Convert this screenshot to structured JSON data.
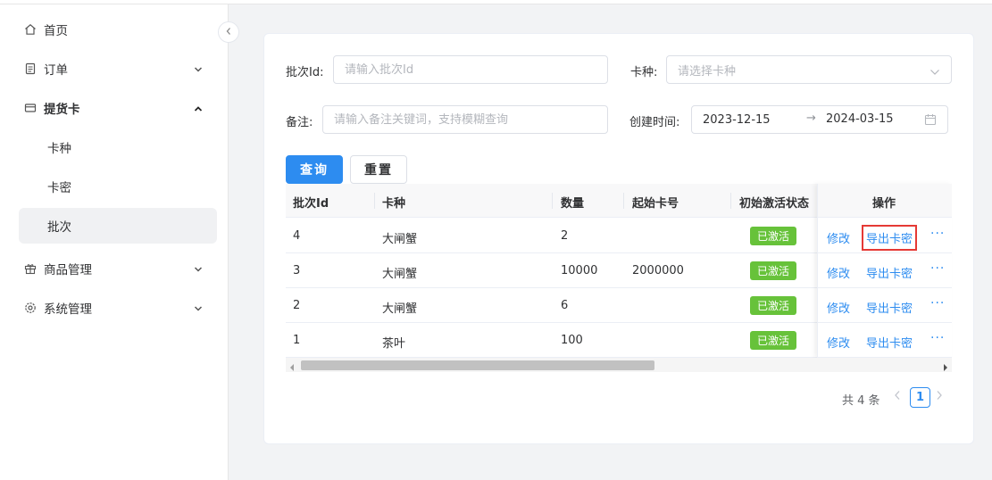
{
  "sidebar": {
    "items": [
      {
        "label": "首页",
        "icon": "home-icon"
      },
      {
        "label": "订单",
        "icon": "order-icon"
      },
      {
        "label": "提货卡",
        "icon": "card-icon"
      },
      {
        "label": "卡种"
      },
      {
        "label": "卡密"
      },
      {
        "label": "批次"
      },
      {
        "label": "商品管理",
        "icon": "gift-icon"
      },
      {
        "label": "系统管理",
        "icon": "settings-icon"
      }
    ],
    "active_item": "批次"
  },
  "filters": {
    "batch_id": {
      "label": "批次Id:",
      "placeholder": "请输入批次Id"
    },
    "card_type": {
      "label": "卡种:",
      "placeholder": "请选择卡种"
    },
    "remark": {
      "label": "备注:",
      "placeholder": "请输入备注关键词，支持模糊查询"
    },
    "created_time": {
      "label": "创建时间:",
      "start": "2023-12-15",
      "separator": "→",
      "end": "2024-03-15"
    }
  },
  "buttons": {
    "search": "查询",
    "reset": "重置"
  },
  "table": {
    "columns": [
      "批次Id",
      "卡种",
      "数量",
      "起始卡号",
      "初始激活状态",
      "操作"
    ],
    "rows": [
      {
        "id": "4",
        "card_type": "大闸蟹",
        "quantity": "2",
        "start_no": "",
        "status": "已激活"
      },
      {
        "id": "3",
        "card_type": "大闸蟹",
        "quantity": "10000",
        "start_no": "2000000",
        "status": "已激活"
      },
      {
        "id": "2",
        "card_type": "大闸蟹",
        "quantity": "6",
        "start_no": "",
        "status": "已激活"
      },
      {
        "id": "1",
        "card_type": "茶叶",
        "quantity": "100",
        "start_no": "",
        "status": "已激活"
      }
    ],
    "actions": {
      "edit": "修改",
      "export": "导出卡密",
      "more": "···"
    }
  },
  "pagination": {
    "total": "共 4 条",
    "current_page": "1"
  },
  "colors": {
    "primary": "#2d8cf0",
    "success": "#67c23a",
    "highlight": "#e53935"
  }
}
